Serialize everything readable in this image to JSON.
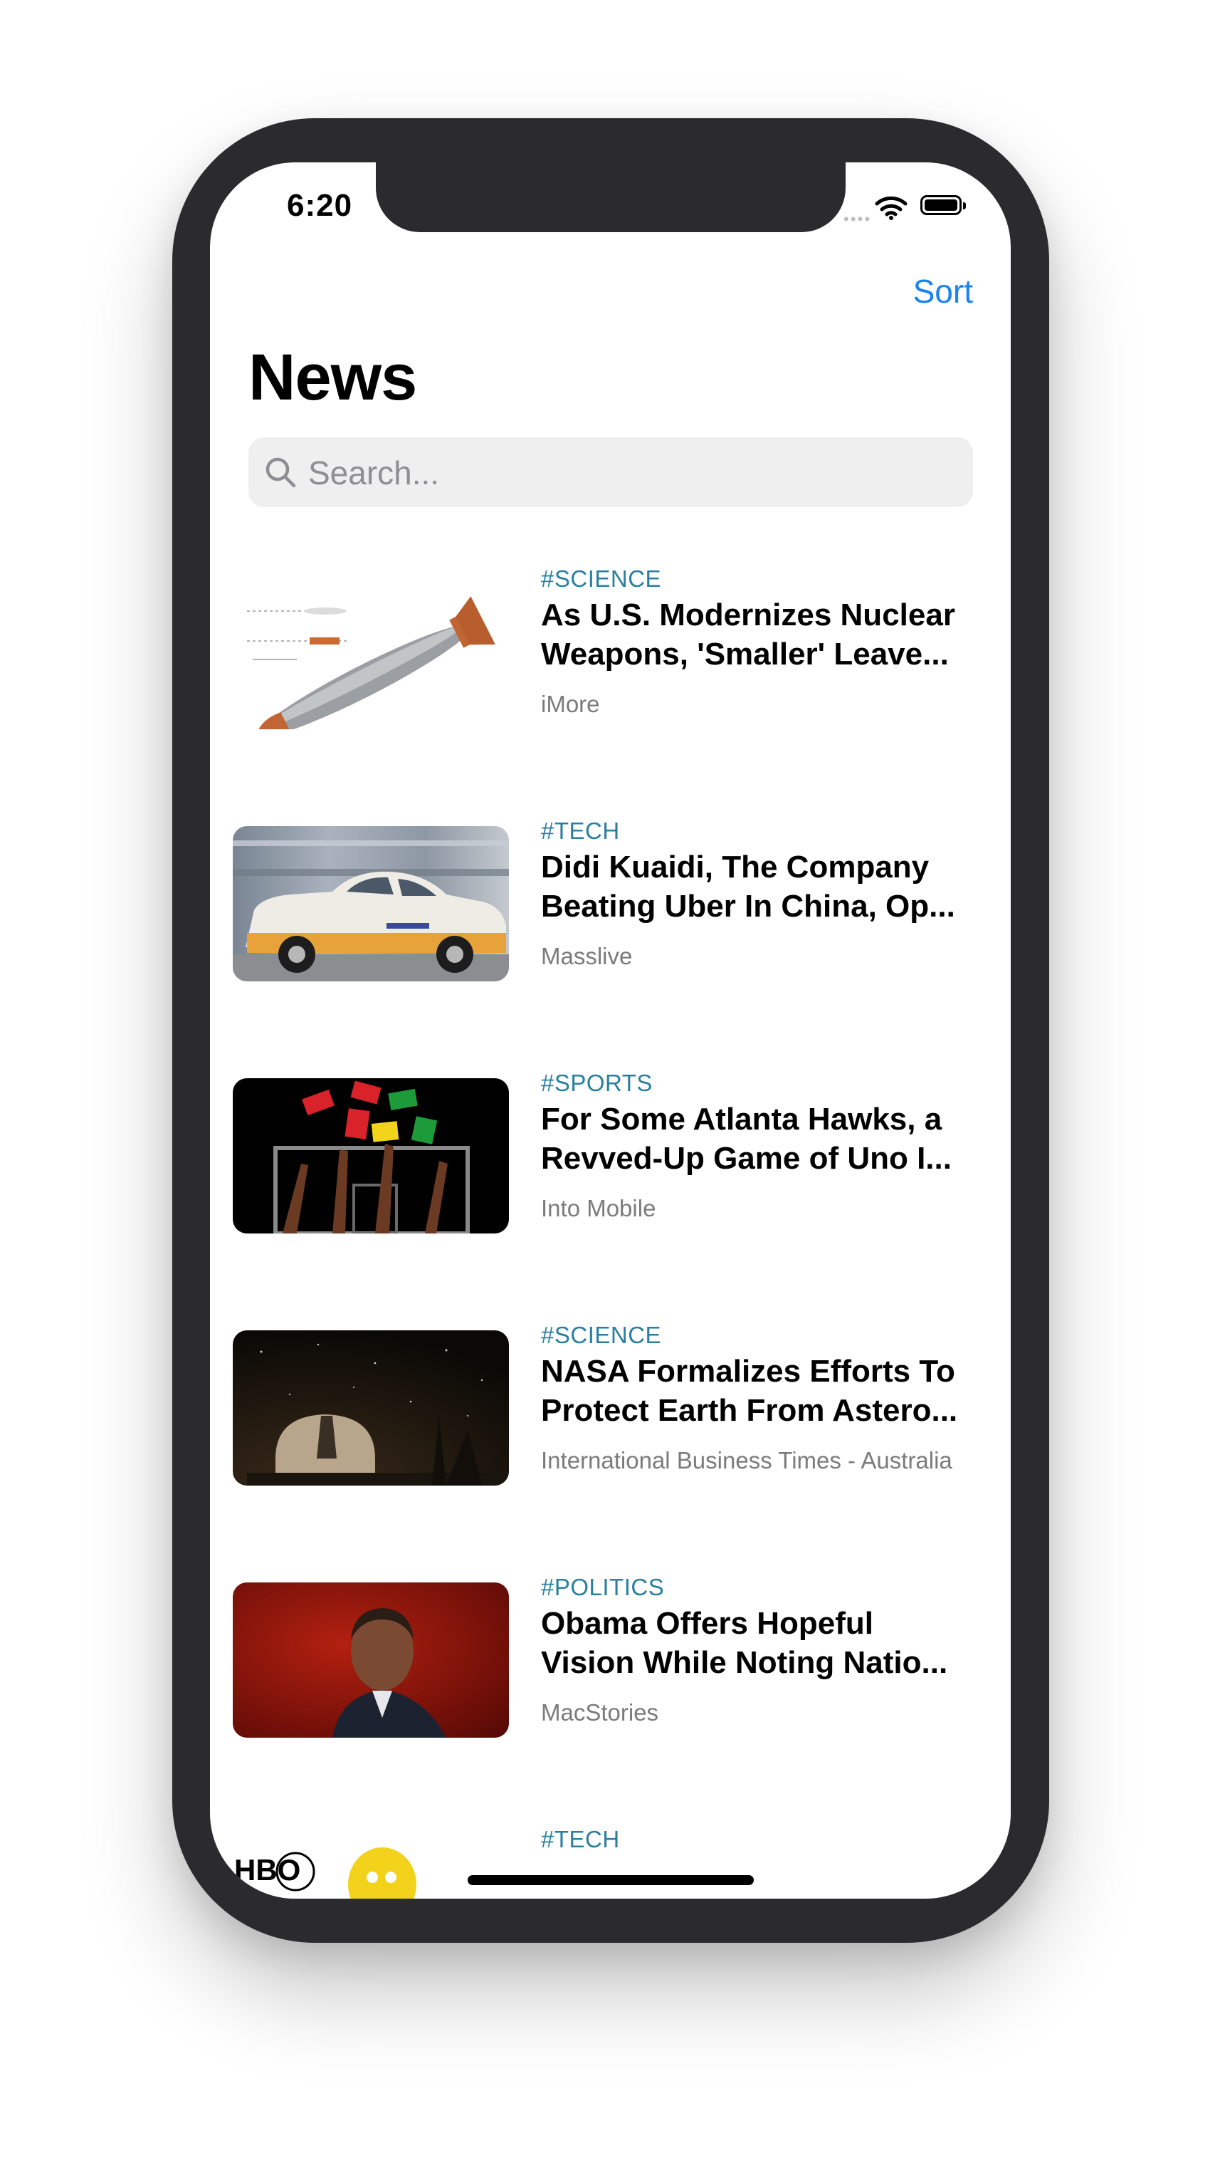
{
  "status_bar": {
    "time": "6:20"
  },
  "nav": {
    "sort_label": "Sort",
    "title": "News"
  },
  "search": {
    "placeholder": "Search..."
  },
  "articles": [
    {
      "tag": "#SCIENCE",
      "headline": "As U.S. Modernizes Nuclear\nWeapons, 'Smaller' Leave...",
      "source": "iMore",
      "image_icon": "bomb-image"
    },
    {
      "tag": "#TECH",
      "headline": "Didi Kuaidi, The Company\nBeating Uber In China, Op...",
      "source": "Masslive",
      "image_icon": "taxi-image"
    },
    {
      "tag": "#SPORTS",
      "headline": "For Some Atlanta Hawks, a\nRevved-Up Game of Uno I...",
      "source": "Into Mobile",
      "image_icon": "uno-cards-image"
    },
    {
      "tag": "#SCIENCE",
      "headline": "NASA Formalizes Efforts To\nProtect Earth From Astero...",
      "source": "International Business Times - Australia",
      "image_icon": "observatory-image"
    },
    {
      "tag": "#POLITICS",
      "headline": "Obama Offers Hopeful\nVision While Noting Natio...",
      "source": "MacStories",
      "image_icon": "portrait-image"
    },
    {
      "tag": "#TECH",
      "headline": "",
      "source": "",
      "image_icon": "hbo-logo-image"
    }
  ],
  "colors": {
    "accent": "#1a82f2",
    "tag": "#2a7fa0",
    "source": "#7b7b7b",
    "search_bg": "#efeff0"
  }
}
